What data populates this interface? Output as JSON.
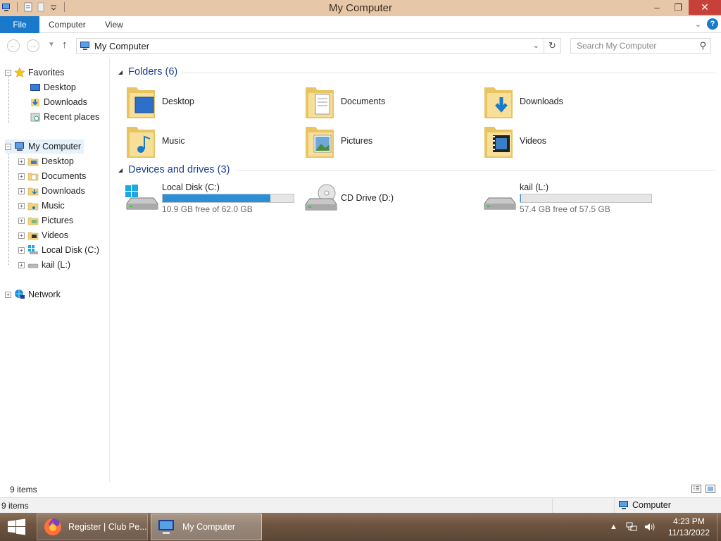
{
  "window": {
    "title": "My Computer"
  },
  "ribbon": {
    "file": "File",
    "tabs": [
      "Computer",
      "View"
    ],
    "help": "?"
  },
  "nav": {
    "address": "My Computer",
    "search_placeholder": "Search My Computer"
  },
  "tree": {
    "favorites": "Favorites",
    "fav_items": [
      "Desktop",
      "Downloads",
      "Recent places"
    ],
    "computer": "My Computer",
    "computer_items": [
      "Desktop",
      "Documents",
      "Downloads",
      "Music",
      "Pictures",
      "Videos",
      "Local Disk (C:)",
      "kail (L:)"
    ],
    "network": "Network"
  },
  "content": {
    "folders_heading": "Folders (6)",
    "folders": [
      "Desktop",
      "Documents",
      "Downloads",
      "Music",
      "Pictures",
      "Videos"
    ],
    "drives_heading": "Devices and drives (3)",
    "drives": [
      {
        "name": "Local Disk (C:)",
        "free": "10.9 GB free of 62.0 GB",
        "used_fraction": 0.82
      },
      {
        "name": "CD Drive (D:)"
      },
      {
        "name": "kail (L:)",
        "free": "57.4 GB free of 57.5 GB",
        "used_fraction": 0.002
      }
    ]
  },
  "status": {
    "items_top": "9 items",
    "items_bottom": "9 items",
    "zone": "Computer"
  },
  "taskbar": {
    "firefox": "Register | Club Pe...",
    "explorer": "My Computer",
    "time": "4:23 PM",
    "date": "11/13/2022"
  },
  "colors": {
    "accent": "#1979ca",
    "titlebar": "#e6c8a8",
    "close": "#c7413a",
    "drive_bar": "#2a8fd6"
  },
  "icons": [
    "computer-icon",
    "folder-icon",
    "star-icon",
    "drive-icon",
    "cd-drive-icon",
    "network-icon",
    "windows-logo-icon",
    "firefox-icon"
  ]
}
